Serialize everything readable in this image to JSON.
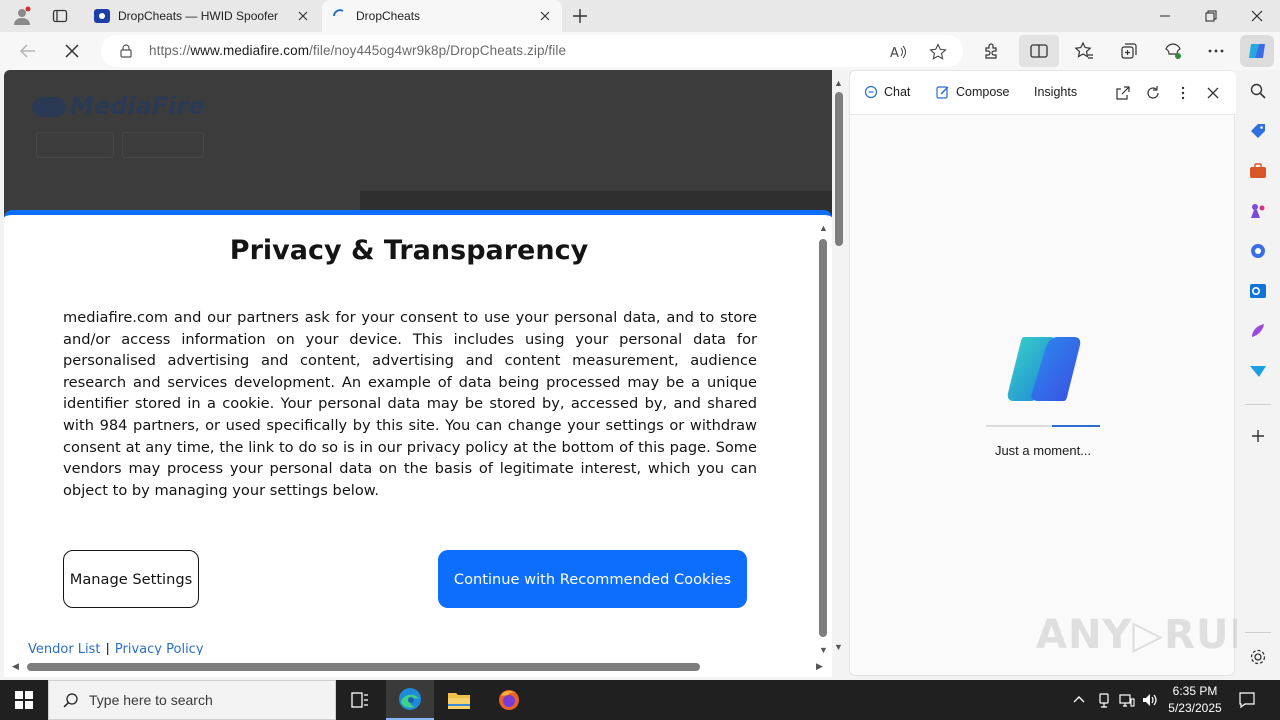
{
  "browser": {
    "tabs": [
      {
        "title": "DropCheats — HWID Spoofer",
        "active": false
      },
      {
        "title": "DropCheats",
        "active": true
      }
    ],
    "address": {
      "prefix": "https://",
      "domain": "www.mediafire.com",
      "path": "/file/noy445og4wr9k8p/DropCheats.zip/file"
    }
  },
  "modal": {
    "title": "Privacy & Transparency",
    "body": "mediafire.com and our partners ask for your consent to use your personal data, and to store and/or access information on your device. This includes using your personal data for personalised advertising and content, advertising and content measurement, audience research and services development. An example of data being processed may be a unique identifier stored in a cookie. Your personal data may be stored by, accessed by, and shared with 984 partners, or used specifically by this site. You can change your settings or withdraw consent at any time, the link to do so is in our privacy policy at the bottom of this page. Some vendors may process your personal data on the basis of legitimate interest, which you can object to by managing your settings below.",
    "manage_label": "Manage Settings",
    "continue_label": "Continue with Recommended Cookies",
    "vendor_link": "Vendor List",
    "separator": "|",
    "privacy_link": "Privacy Policy",
    "accent_color": "#0d6efd"
  },
  "page_behind": {
    "logo_text": "MediaFire"
  },
  "copilot": {
    "tabs": [
      "Chat",
      "Compose",
      "Insights"
    ],
    "loading_text": "Just a moment..."
  },
  "watermark": "ANY▷RUN",
  "taskbar": {
    "search_placeholder": "Type here to search",
    "time": "6:35 PM",
    "date": "5/23/2025"
  }
}
